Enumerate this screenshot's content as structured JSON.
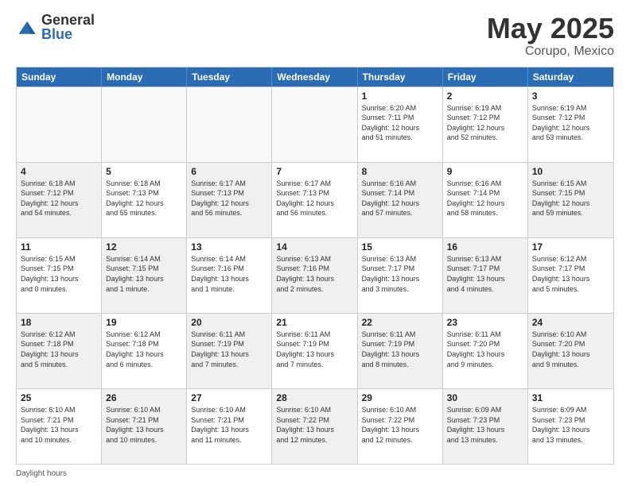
{
  "header": {
    "logo_general": "General",
    "logo_blue": "Blue",
    "main_title": "May 2025",
    "subtitle": "Corupo, Mexico"
  },
  "calendar": {
    "days_of_week": [
      "Sunday",
      "Monday",
      "Tuesday",
      "Wednesday",
      "Thursday",
      "Friday",
      "Saturday"
    ],
    "rows": [
      {
        "cells": [
          {
            "empty": true
          },
          {
            "empty": true
          },
          {
            "empty": true
          },
          {
            "empty": true
          },
          {
            "day": "1",
            "lines": [
              "Sunrise: 6:20 AM",
              "Sunset: 7:11 PM",
              "Daylight: 12 hours",
              "and 51 minutes."
            ]
          },
          {
            "day": "2",
            "lines": [
              "Sunrise: 6:19 AM",
              "Sunset: 7:12 PM",
              "Daylight: 12 hours",
              "and 52 minutes."
            ]
          },
          {
            "day": "3",
            "lines": [
              "Sunrise: 6:19 AM",
              "Sunset: 7:12 PM",
              "Daylight: 12 hours",
              "and 53 minutes."
            ]
          }
        ]
      },
      {
        "cells": [
          {
            "day": "4",
            "shaded": true,
            "lines": [
              "Sunrise: 6:18 AM",
              "Sunset: 7:12 PM",
              "Daylight: 12 hours",
              "and 54 minutes."
            ]
          },
          {
            "day": "5",
            "lines": [
              "Sunrise: 6:18 AM",
              "Sunset: 7:13 PM",
              "Daylight: 12 hours",
              "and 55 minutes."
            ]
          },
          {
            "day": "6",
            "shaded": true,
            "lines": [
              "Sunrise: 6:17 AM",
              "Sunset: 7:13 PM",
              "Daylight: 12 hours",
              "and 56 minutes."
            ]
          },
          {
            "day": "7",
            "lines": [
              "Sunrise: 6:17 AM",
              "Sunset: 7:13 PM",
              "Daylight: 12 hours",
              "and 56 minutes."
            ]
          },
          {
            "day": "8",
            "shaded": true,
            "lines": [
              "Sunrise: 6:16 AM",
              "Sunset: 7:14 PM",
              "Daylight: 12 hours",
              "and 57 minutes."
            ]
          },
          {
            "day": "9",
            "lines": [
              "Sunrise: 6:16 AM",
              "Sunset: 7:14 PM",
              "Daylight: 12 hours",
              "and 58 minutes."
            ]
          },
          {
            "day": "10",
            "shaded": true,
            "lines": [
              "Sunrise: 6:15 AM",
              "Sunset: 7:15 PM",
              "Daylight: 12 hours",
              "and 59 minutes."
            ]
          }
        ]
      },
      {
        "cells": [
          {
            "day": "11",
            "lines": [
              "Sunrise: 6:15 AM",
              "Sunset: 7:15 PM",
              "Daylight: 13 hours",
              "and 0 minutes."
            ]
          },
          {
            "day": "12",
            "shaded": true,
            "lines": [
              "Sunrise: 6:14 AM",
              "Sunset: 7:15 PM",
              "Daylight: 13 hours",
              "and 1 minute."
            ]
          },
          {
            "day": "13",
            "lines": [
              "Sunrise: 6:14 AM",
              "Sunset: 7:16 PM",
              "Daylight: 13 hours",
              "and 1 minute."
            ]
          },
          {
            "day": "14",
            "shaded": true,
            "lines": [
              "Sunrise: 6:13 AM",
              "Sunset: 7:16 PM",
              "Daylight: 13 hours",
              "and 2 minutes."
            ]
          },
          {
            "day": "15",
            "lines": [
              "Sunrise: 6:13 AM",
              "Sunset: 7:17 PM",
              "Daylight: 13 hours",
              "and 3 minutes."
            ]
          },
          {
            "day": "16",
            "shaded": true,
            "lines": [
              "Sunrise: 6:13 AM",
              "Sunset: 7:17 PM",
              "Daylight: 13 hours",
              "and 4 minutes."
            ]
          },
          {
            "day": "17",
            "lines": [
              "Sunrise: 6:12 AM",
              "Sunset: 7:17 PM",
              "Daylight: 13 hours",
              "and 5 minutes."
            ]
          }
        ]
      },
      {
        "cells": [
          {
            "day": "18",
            "shaded": true,
            "lines": [
              "Sunrise: 6:12 AM",
              "Sunset: 7:18 PM",
              "Daylight: 13 hours",
              "and 5 minutes."
            ]
          },
          {
            "day": "19",
            "lines": [
              "Sunrise: 6:12 AM",
              "Sunset: 7:18 PM",
              "Daylight: 13 hours",
              "and 6 minutes."
            ]
          },
          {
            "day": "20",
            "shaded": true,
            "lines": [
              "Sunrise: 6:11 AM",
              "Sunset: 7:19 PM",
              "Daylight: 13 hours",
              "and 7 minutes."
            ]
          },
          {
            "day": "21",
            "lines": [
              "Sunrise: 6:11 AM",
              "Sunset: 7:19 PM",
              "Daylight: 13 hours",
              "and 7 minutes."
            ]
          },
          {
            "day": "22",
            "shaded": true,
            "lines": [
              "Sunrise: 6:11 AM",
              "Sunset: 7:19 PM",
              "Daylight: 13 hours",
              "and 8 minutes."
            ]
          },
          {
            "day": "23",
            "lines": [
              "Sunrise: 6:11 AM",
              "Sunset: 7:20 PM",
              "Daylight: 13 hours",
              "and 9 minutes."
            ]
          },
          {
            "day": "24",
            "shaded": true,
            "lines": [
              "Sunrise: 6:10 AM",
              "Sunset: 7:20 PM",
              "Daylight: 13 hours",
              "and 9 minutes."
            ]
          }
        ]
      },
      {
        "cells": [
          {
            "day": "25",
            "lines": [
              "Sunrise: 6:10 AM",
              "Sunset: 7:21 PM",
              "Daylight: 13 hours",
              "and 10 minutes."
            ]
          },
          {
            "day": "26",
            "shaded": true,
            "lines": [
              "Sunrise: 6:10 AM",
              "Sunset: 7:21 PM",
              "Daylight: 13 hours",
              "and 10 minutes."
            ]
          },
          {
            "day": "27",
            "lines": [
              "Sunrise: 6:10 AM",
              "Sunset: 7:21 PM",
              "Daylight: 13 hours",
              "and 11 minutes."
            ]
          },
          {
            "day": "28",
            "shaded": true,
            "lines": [
              "Sunrise: 6:10 AM",
              "Sunset: 7:22 PM",
              "Daylight: 13 hours",
              "and 12 minutes."
            ]
          },
          {
            "day": "29",
            "lines": [
              "Sunrise: 6:10 AM",
              "Sunset: 7:22 PM",
              "Daylight: 13 hours",
              "and 12 minutes."
            ]
          },
          {
            "day": "30",
            "shaded": true,
            "lines": [
              "Sunrise: 6:09 AM",
              "Sunset: 7:23 PM",
              "Daylight: 13 hours",
              "and 13 minutes."
            ]
          },
          {
            "day": "31",
            "lines": [
              "Sunrise: 6:09 AM",
              "Sunset: 7:23 PM",
              "Daylight: 13 hours",
              "and 13 minutes."
            ]
          }
        ]
      }
    ]
  },
  "footer": {
    "text": "Daylight hours"
  }
}
